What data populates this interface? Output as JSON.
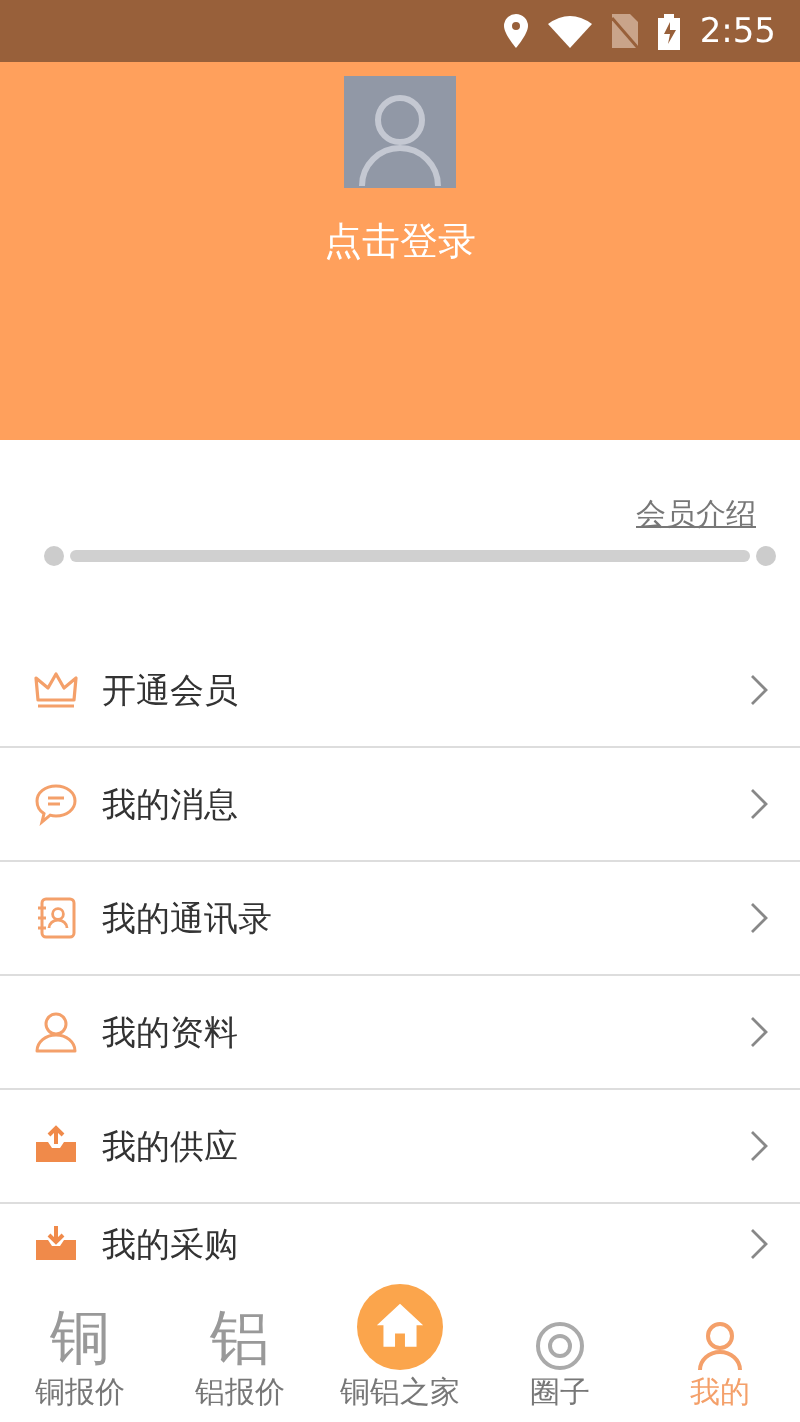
{
  "status_bar": {
    "time": "2:55"
  },
  "header": {
    "login_label": "点击登录"
  },
  "membership": {
    "link": "会员介绍"
  },
  "menu": [
    {
      "kind": "crown",
      "label": "开通会员"
    },
    {
      "kind": "message",
      "label": "我的消息"
    },
    {
      "kind": "contacts",
      "label": "我的通讯录"
    },
    {
      "kind": "profile",
      "label": "我的资料"
    },
    {
      "kind": "supply",
      "label": "我的供应"
    },
    {
      "kind": "purchase",
      "label": "我的采购"
    }
  ],
  "bottom_nav": [
    {
      "kind": "glyph",
      "icon_text": "铜",
      "label": "铜报价",
      "selected": false
    },
    {
      "kind": "glyph",
      "icon_text": "铝",
      "label": "铝报价",
      "selected": false
    },
    {
      "kind": "home",
      "label": "铜铝之家",
      "selected": false
    },
    {
      "kind": "circle",
      "label": "圈子",
      "selected": false
    },
    {
      "kind": "person",
      "label": "我的",
      "selected": true
    }
  ]
}
